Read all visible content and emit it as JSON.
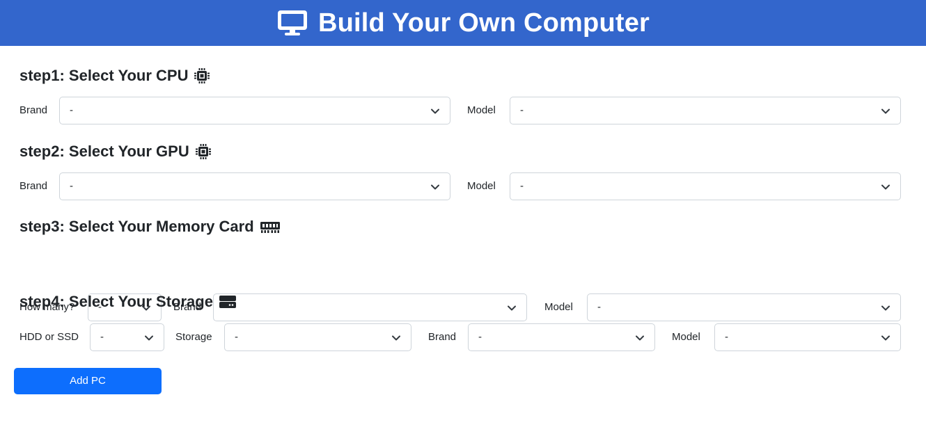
{
  "header": {
    "title": "Build Your Own Computer",
    "icon": "desktop-icon"
  },
  "steps": [
    {
      "title": "step1: Select Your CPU",
      "icon": "microchip-icon",
      "fields": [
        {
          "label": "Brand",
          "value": "-"
        },
        {
          "label": "Model",
          "value": "-"
        }
      ]
    },
    {
      "title": "step2: Select Your GPU",
      "icon": "microchip-icon",
      "fields": [
        {
          "label": "Brand",
          "value": "-"
        },
        {
          "label": "Model",
          "value": "-"
        }
      ]
    },
    {
      "title": "step3: Select Your Memory Card",
      "icon": "memory-icon",
      "fields": [
        {
          "label": "How many?",
          "value": "-"
        },
        {
          "label": "Brand",
          "value": "-"
        },
        {
          "label": "Model",
          "value": "-"
        }
      ]
    },
    {
      "title": "step4: Select Your Storage",
      "icon": "hdd-icon",
      "fields": [
        {
          "label": "HDD or SSD",
          "value": "-"
        },
        {
          "label": "Storage",
          "value": "-"
        },
        {
          "label": "Brand",
          "value": "-"
        },
        {
          "label": "Model",
          "value": "-"
        }
      ]
    }
  ],
  "actions": {
    "add_pc_label": "Add PC"
  },
  "colors": {
    "header_bg": "#3366cc",
    "primary_button": "#0d6efd",
    "select_border": "#ced4da"
  }
}
